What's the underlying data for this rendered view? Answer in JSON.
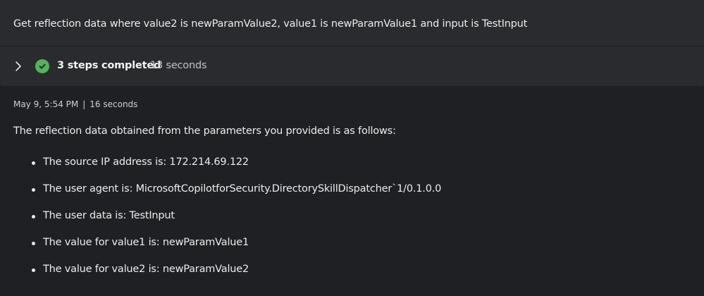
{
  "prompt": {
    "text": "Get reflection data where value2 is newParamValue2, value1 is newParamValue1 and input is TestInput"
  },
  "steps": {
    "label": "3 steps completed",
    "duration": "13 seconds",
    "status_icon": "check-circle-icon",
    "expand_icon": "chevron-right-icon",
    "status_color": "#54b35a"
  },
  "response": {
    "timestamp": "May 9, 5:54 PM",
    "separator": "|",
    "elapsed": "16 seconds",
    "intro": "The reflection data obtained from the parameters you provided is as follows:",
    "items": [
      "The source IP address is: 172.214.69.122",
      "The user agent is: MicrosoftCopilotforSecurity.DirectorySkillDispatcher`1/0.1.0.0",
      "The user data is: TestInput",
      "The value for value1 is: newParamValue1",
      "The value for value2 is: newParamValue2"
    ]
  }
}
